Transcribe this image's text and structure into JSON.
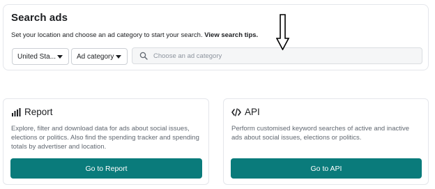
{
  "search": {
    "title": "Search ads",
    "description_prefix": "Set your location and choose an ad category to start your search. ",
    "tips_link": "View search tips.",
    "country_value": "United Sta...",
    "category_value": "Ad category",
    "placeholder": "Choose an ad category"
  },
  "report": {
    "title": "Report",
    "description": "Explore, filter and download data for ads about social issues, elections or politics. Also find the spending tracker and spending totals by advertiser and location.",
    "button": "Go to Report",
    "icon": "bar-chart-icon"
  },
  "api": {
    "title": "API",
    "description": "Perform customised keyword searches of active and inactive ads about social issues, elections or politics.",
    "button": "Go to API",
    "icon": "code-icon"
  },
  "colors": {
    "button_bg": "#0a7b7b",
    "text_primary": "#1c1e21",
    "text_secondary": "#606770"
  }
}
